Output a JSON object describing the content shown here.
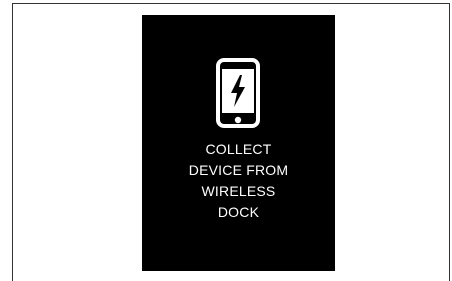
{
  "display": {
    "icon": "phone-charging-icon",
    "message_lines": [
      "COLLECT",
      "DEVICE FROM",
      "WIRELESS",
      "DOCK"
    ]
  },
  "colors": {
    "display_background": "#000000",
    "display_text": "#ffffff",
    "frame_border": "#333333"
  }
}
